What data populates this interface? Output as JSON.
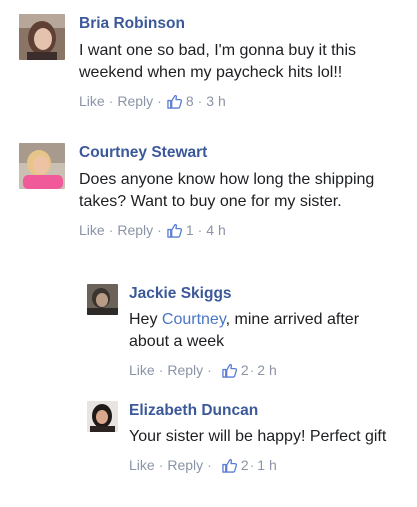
{
  "comments": [
    {
      "author": "Bria Robinson",
      "text": "I want one so bad, I'm gonna buy it this weekend when my paycheck hits lol!!",
      "like_label": "Like",
      "reply_label": "Reply",
      "likes": "8",
      "time": "3 h"
    },
    {
      "author": "Courtney Stewart",
      "text": "Does anyone know how long the shipping takes? Want to buy one for my sister.",
      "like_label": "Like",
      "reply_label": "Reply",
      "likes": "1",
      "time": "4 h"
    },
    {
      "author": "Jackie Skiggs",
      "text_prefix": "Hey ",
      "mention": "Courtney",
      "text_suffix": ", mine arrived after about a week",
      "like_label": "Like",
      "reply_label": "Reply",
      "likes": "2",
      "time": "2 h"
    },
    {
      "author": "Elizabeth Duncan",
      "text": "Your sister will be happy! Perfect gift",
      "like_label": "Like",
      "reply_label": "Reply",
      "likes": "2",
      "time": "1 h"
    }
  ],
  "colors": {
    "author": "#3b5998",
    "mention": "#4a76c6",
    "meta": "#8a94a6",
    "like_thumb": "#5b7bd5"
  },
  "icons": {
    "reaction": "thumbs-up-icon"
  }
}
